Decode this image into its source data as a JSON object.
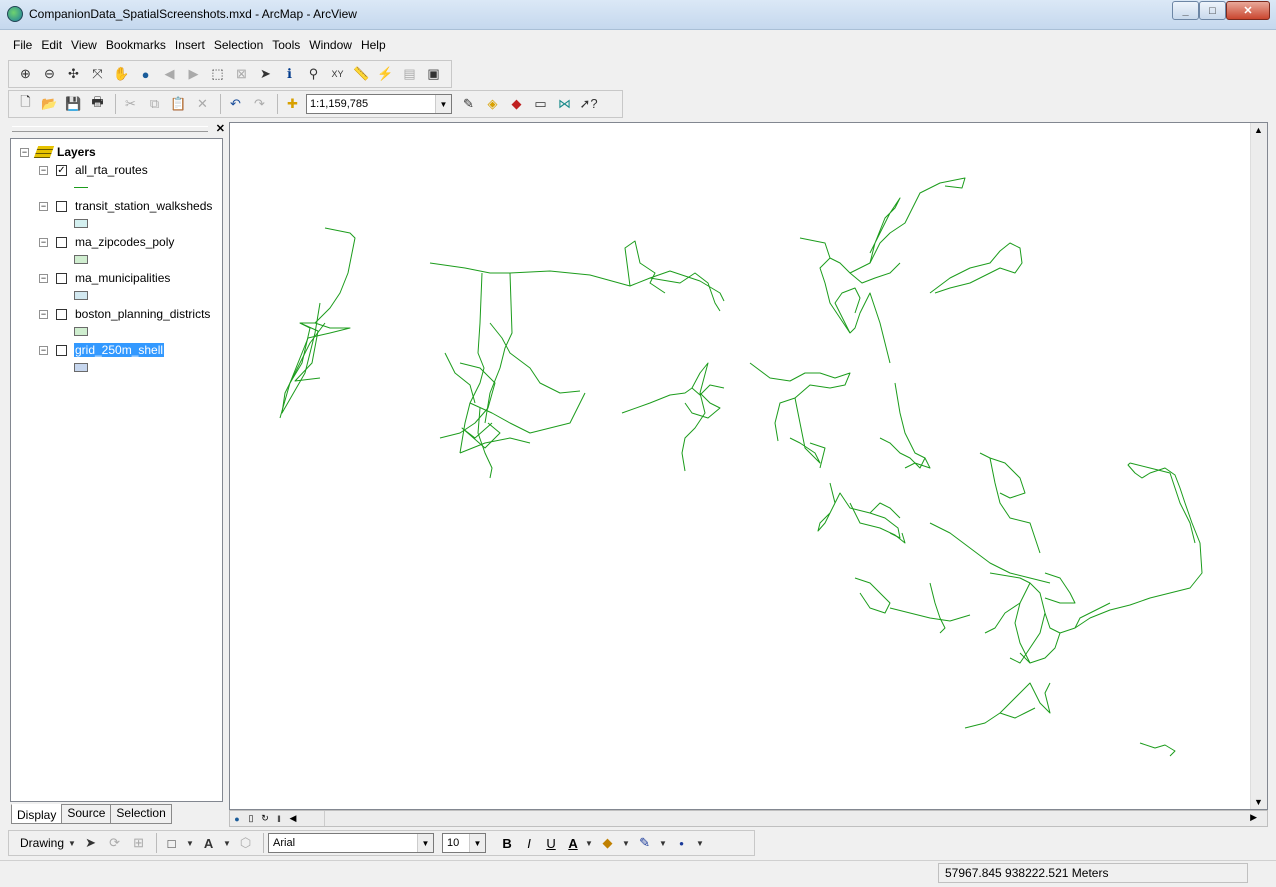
{
  "window": {
    "title": "CompanionData_SpatialScreenshots.mxd - ArcMap - ArcView",
    "buttons": [
      "_",
      "□",
      "✕"
    ]
  },
  "menu": [
    "File",
    "Edit",
    "View",
    "Bookmarks",
    "Insert",
    "Selection",
    "Tools",
    "Window",
    "Help"
  ],
  "tools_toolbar": {
    "icons": [
      "zoom-in-icon",
      "zoom-out-icon",
      "fixed-zoom-in-icon",
      "fixed-zoom-out-icon",
      "pan-icon",
      "full-extent-icon",
      "go-back-icon",
      "go-forward-icon",
      "select-features-icon",
      "clear-selection-icon",
      "select-elements-icon",
      "identify-icon",
      "find-icon",
      "goto-xy-icon",
      "measure-icon",
      "hyperlink-icon",
      "html-popup-icon",
      "viewer-icon"
    ]
  },
  "standard_toolbar": {
    "scale_value": "1:1,159,785"
  },
  "toc": {
    "root_label": "Layers",
    "layers": [
      {
        "name": "all_rta_routes",
        "checked": true,
        "symbol": "line",
        "color": "#1c9c1c"
      },
      {
        "name": "transit_station_walksheds",
        "checked": false,
        "symbol": "polygon",
        "color": "#d4f0f0"
      },
      {
        "name": "ma_zipcodes_poly",
        "checked": false,
        "symbol": "polygon",
        "color": "#d0eed0"
      },
      {
        "name": "ma_municipalities",
        "checked": false,
        "symbol": "polygon",
        "color": "#d2e8f0"
      },
      {
        "name": "boston_planning_districts",
        "checked": false,
        "symbol": "polygon",
        "color": "#cfeecf"
      },
      {
        "name": "grid_250m_shell",
        "checked": false,
        "symbol": "polygon",
        "color": "#c6d6ee",
        "selected": true
      }
    ],
    "tabs": [
      "Display",
      "Source",
      "Selection"
    ],
    "close_glyph": "✕"
  },
  "map": {
    "route_color": "#1c9c1c"
  },
  "drawing_toolbar": {
    "label": "Drawing",
    "font": "Arial",
    "size": "10",
    "bold": "B",
    "italic": "I",
    "underline": "U",
    "font_color_glyph": "A"
  },
  "status": {
    "coordinates": "57967.845  938222.521 Meters"
  }
}
